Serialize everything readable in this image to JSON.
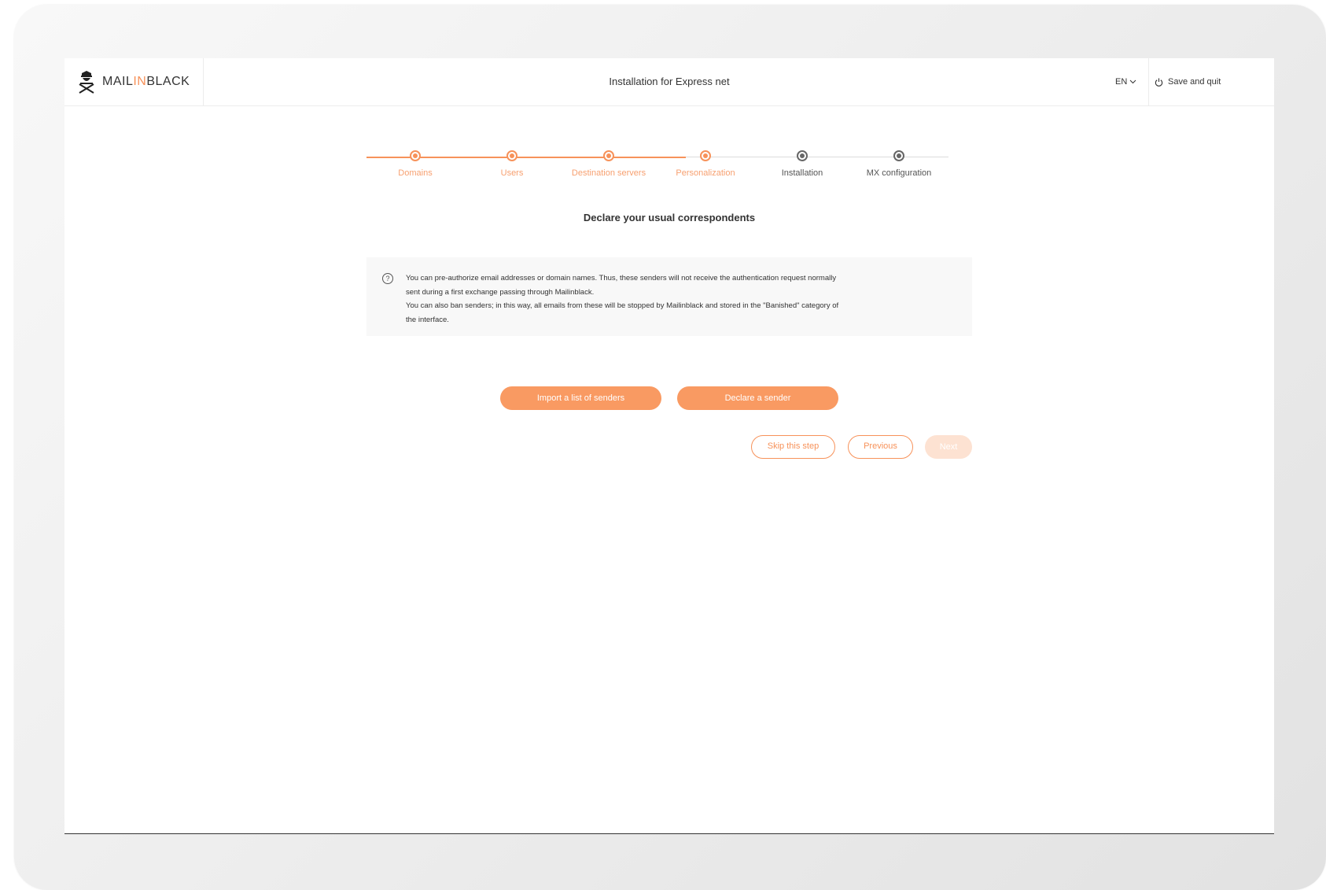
{
  "header": {
    "logo_prefix": "MAIL",
    "logo_accent": "IN",
    "logo_suffix": "BLACK",
    "title": "Installation for Express net",
    "language": "EN",
    "save_quit_label": "Save and quit"
  },
  "stepper": {
    "steps": [
      {
        "label": "Domains",
        "state": "done"
      },
      {
        "label": "Users",
        "state": "done"
      },
      {
        "label": "Destination servers",
        "state": "done"
      },
      {
        "label": "Personalization",
        "state": "done"
      },
      {
        "label": "Installation",
        "state": "todo"
      },
      {
        "label": "MX configuration",
        "state": "todo"
      }
    ]
  },
  "main": {
    "title": "Declare your usual correspondents",
    "info_lines": [
      "You can pre-authorize email addresses or domain names. Thus, these senders will not receive the authentication request normally",
      "sent during a first exchange passing through Mailinblack.",
      "You can also ban senders; in this way, all emails from these will be stopped by Mailinblack and stored in the \"Banished\" category of",
      "the interface."
    ],
    "import_button": "Import a list of senders",
    "declare_button": "Declare a sender",
    "skip_button": "Skip this step",
    "previous_button": "Previous",
    "next_button": "Next"
  },
  "colors": {
    "accent": "#f7925a",
    "disabled": "#fde2d2",
    "text": "#333333"
  }
}
